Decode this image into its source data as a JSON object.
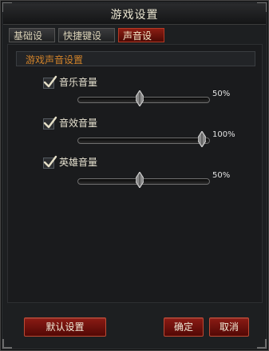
{
  "dialog": {
    "title": "游戏设置"
  },
  "tabs": [
    {
      "label": "基础设置",
      "active": false
    },
    {
      "label": "快捷键设置",
      "active": false
    },
    {
      "label": "声音设置",
      "active": true
    }
  ],
  "section": {
    "title": "游戏声音设置"
  },
  "sliders": [
    {
      "label": "音乐音量",
      "checked": true,
      "value_fraction": 0.5,
      "value_text": "50%"
    },
    {
      "label": "音效音量",
      "checked": true,
      "value_fraction": 1.0,
      "value_text": "100%"
    },
    {
      "label": "英雄音量",
      "checked": true,
      "value_fraction": 0.5,
      "value_text": "50%"
    }
  ],
  "buttons": {
    "default_label": "默认设置",
    "confirm_label": "确定",
    "cancel_label": "取消"
  },
  "colors": {
    "accent_red": "#8a1b14",
    "section_orange": "#d2832a",
    "panel_bg": "#1d1f21"
  },
  "icons": {
    "checkbox": "checkmark-icon"
  }
}
